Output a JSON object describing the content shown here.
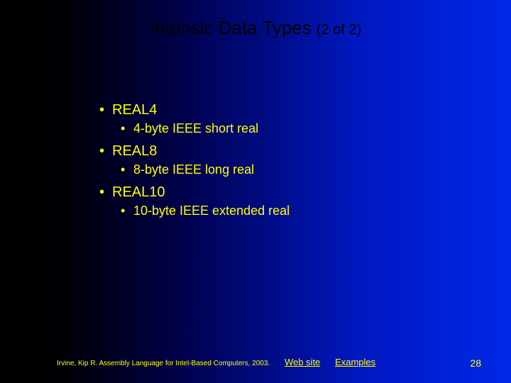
{
  "title": {
    "main": "Intrinsic Data Types ",
    "sub": "(2 of 2)"
  },
  "items": [
    {
      "head": "REAL4",
      "desc": "4-byte IEEE short real"
    },
    {
      "head": "REAL8",
      "desc": "8-byte IEEE long real"
    },
    {
      "head": "REAL10",
      "desc": "10-byte IEEE extended real"
    }
  ],
  "footer": {
    "citation": "Irvine, Kip R. Assembly Language for Intel-Based Computers, 2003.",
    "link1": "Web site",
    "link2": "Examples",
    "slide_number": "28"
  }
}
